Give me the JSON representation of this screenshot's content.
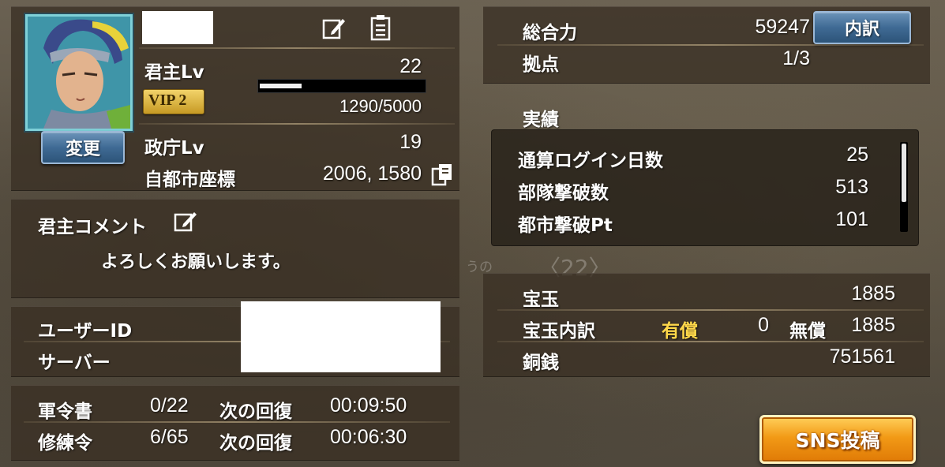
{
  "profile": {
    "change_button": "変更",
    "lord_lv_label": "君主Lv",
    "lord_lv_value": "22",
    "exp_text": "1290/5000",
    "exp_fraction": 0.258,
    "vip_label": "VIP 2",
    "govt_lv_label": "政庁Lv",
    "govt_lv_value": "19",
    "coords_label": "自都市座標",
    "coords_value": "2006, 1580"
  },
  "comment": {
    "label": "君主コメント",
    "text": "よろしくお願いします。"
  },
  "account": {
    "user_id_label": "ユーザーID",
    "server_label": "サーバー"
  },
  "timers": {
    "rows": [
      {
        "label": "軍令書",
        "count": "0/22",
        "next_label": "次の回復",
        "time": "00:09:50"
      },
      {
        "label": "修練令",
        "count": "6/65",
        "next_label": "次の回復",
        "time": "00:06:30"
      }
    ]
  },
  "power": {
    "total_label": "総合力",
    "total_value": "59247",
    "breakdown_button": "内訳",
    "base_label": "拠点",
    "base_value": "1/3"
  },
  "achievements": {
    "title": "実績",
    "rows": [
      {
        "label": "通算ログイン日数",
        "value": "25"
      },
      {
        "label": "部隊撃破数",
        "value": "513"
      },
      {
        "label": "都市撃破Pt",
        "value": "101"
      }
    ]
  },
  "currency": {
    "gems_label": "宝玉",
    "gems_value": "1885",
    "gems_breakdown_label": "宝玉内訳",
    "paid_label": "有償",
    "paid_value": "0",
    "free_label": "無償",
    "free_value": "1885",
    "coins_label": "銅銭",
    "coins_value": "751561"
  },
  "sns_button": "SNS投稿",
  "background_text": {
    "page_indicator": "〈22〉",
    "fragment": "うの"
  },
  "colors": {
    "gold_text": "#ffd84a",
    "vip_badge": "#d9b23a",
    "button_blue": "#3f6a94",
    "sns_orange": "#f08a10"
  },
  "icons": [
    "edit-icon",
    "clipboard-icon",
    "copy-icon"
  ]
}
